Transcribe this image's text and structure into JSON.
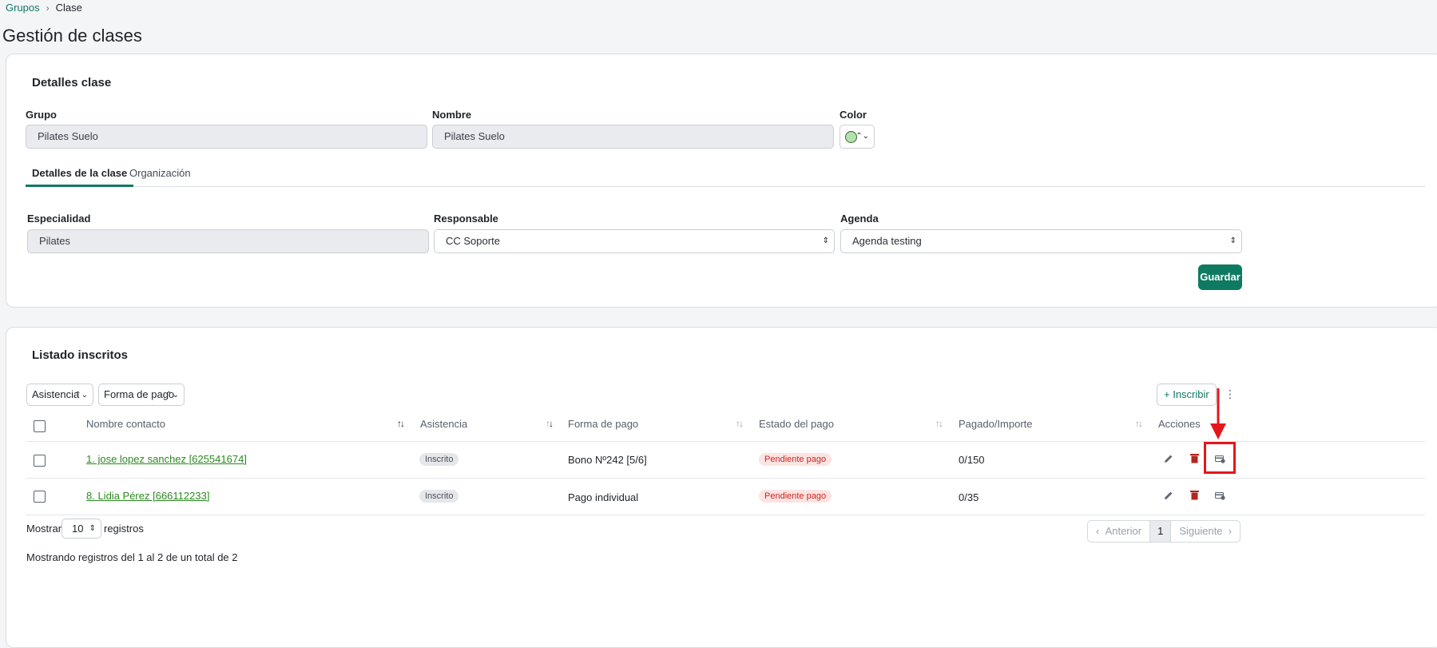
{
  "breadcrumb": {
    "parent": "Grupos",
    "current": "Clase"
  },
  "page_title": "Gestión de clases",
  "details_card": {
    "title": "Detalles clase",
    "group": {
      "label": "Grupo",
      "value": "Pilates Suelo"
    },
    "name": {
      "label": "Nombre",
      "value": "Pilates Suelo"
    },
    "color": {
      "label": "Color",
      "swatch": "#b6dfae"
    },
    "tabs": [
      "Detalles de la clase",
      "Organización"
    ],
    "specialty": {
      "label": "Especialidad",
      "value": "Pilates"
    },
    "responsible": {
      "label": "Responsable",
      "value": "CC Soporte"
    },
    "agenda": {
      "label": "Agenda",
      "value": "Agenda testing"
    },
    "save_label": "Guardar"
  },
  "enrolled_card": {
    "title": "Listado inscritos",
    "filters": [
      "Asistencia",
      "Forma de pago"
    ],
    "enroll_label": "+ Inscribir",
    "columns": [
      "Nombre contacto",
      "Asistencia",
      "Forma de pago",
      "Estado del pago",
      "Pagado/Importe",
      "Acciones"
    ],
    "rows": [
      {
        "contact": "1. jose lopez sanchez [625541674]",
        "attendance": "Inscrito",
        "payment_method": "Bono Nº242 [5/6]",
        "payment_status": "Pendiente pago",
        "paid": "0/150"
      },
      {
        "contact": "8. Lidia Pérez [666112233]",
        "attendance": "Inscrito",
        "payment_method": "Pago individual",
        "payment_status": "Pendiente pago",
        "paid": "0/35"
      }
    ],
    "show_label": "Mostrar",
    "page_size": "10",
    "records_label": "registros",
    "summary": "Mostrando registros del 1 al 2 de un total de 2",
    "pager": {
      "prev": "Anterior",
      "current": "1",
      "next": "Siguiente"
    }
  },
  "colors": {
    "accent": "#0f7a62",
    "danger": "#c8281e",
    "annotation": "#e5161b"
  }
}
